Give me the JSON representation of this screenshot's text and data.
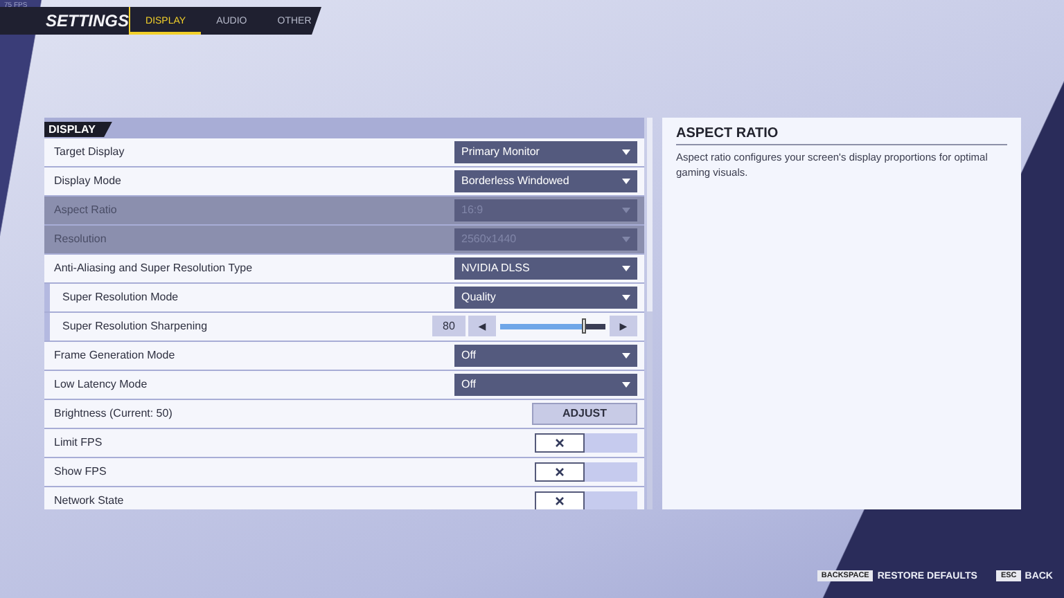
{
  "fps_counter": "75 FPS",
  "header": {
    "title": "SETTINGS",
    "tabs": [
      {
        "label": "DISPLAY",
        "selected": true
      },
      {
        "label": "AUDIO",
        "selected": false
      },
      {
        "label": "OTHER",
        "selected": false
      }
    ]
  },
  "section": {
    "title": "DISPLAY",
    "rows": [
      {
        "kind": "dropdown",
        "label": "Target Display",
        "value": "Primary Monitor",
        "disabled": false
      },
      {
        "kind": "dropdown",
        "label": "Display Mode",
        "value": "Borderless Windowed",
        "disabled": false
      },
      {
        "kind": "dropdown",
        "label": "Aspect Ratio",
        "value": "16:9",
        "disabled": true
      },
      {
        "kind": "dropdown",
        "label": "Resolution",
        "value": "2560x1440",
        "disabled": true
      },
      {
        "kind": "dropdown",
        "label": "Anti-Aliasing and Super Resolution Type",
        "value": "NVIDIA DLSS",
        "disabled": false,
        "children": [
          {
            "kind": "dropdown",
            "label": "Super Resolution Mode",
            "value": "Quality",
            "disabled": false
          },
          {
            "kind": "slider",
            "label": "Super Resolution Sharpening",
            "reading": "80",
            "level": 0.8,
            "left_arrow": "◀",
            "right_arrow": "▶"
          }
        ]
      },
      {
        "kind": "dropdown",
        "label": "Frame Generation Mode",
        "value": "Off",
        "disabled": false
      },
      {
        "kind": "dropdown",
        "label": "Low Latency Mode",
        "value": "Off",
        "disabled": false
      },
      {
        "kind": "button",
        "label": "Brightness (Current: 50)",
        "button": "ADJUST"
      },
      {
        "kind": "toggle",
        "label": "Limit FPS",
        "on": false
      },
      {
        "kind": "toggle",
        "label": "Show FPS",
        "on": false
      },
      {
        "kind": "toggle",
        "label": "Network State",
        "on": false
      }
    ]
  },
  "details": {
    "title": "ASPECT RATIO",
    "text": "Aspect ratio configures your screen's display proportions for optimal gaming visuals."
  },
  "footer": [
    {
      "key": "BACKSPACE",
      "label": "RESTORE DEFAULTS"
    },
    {
      "key": "ESC",
      "label": "BACK"
    }
  ]
}
